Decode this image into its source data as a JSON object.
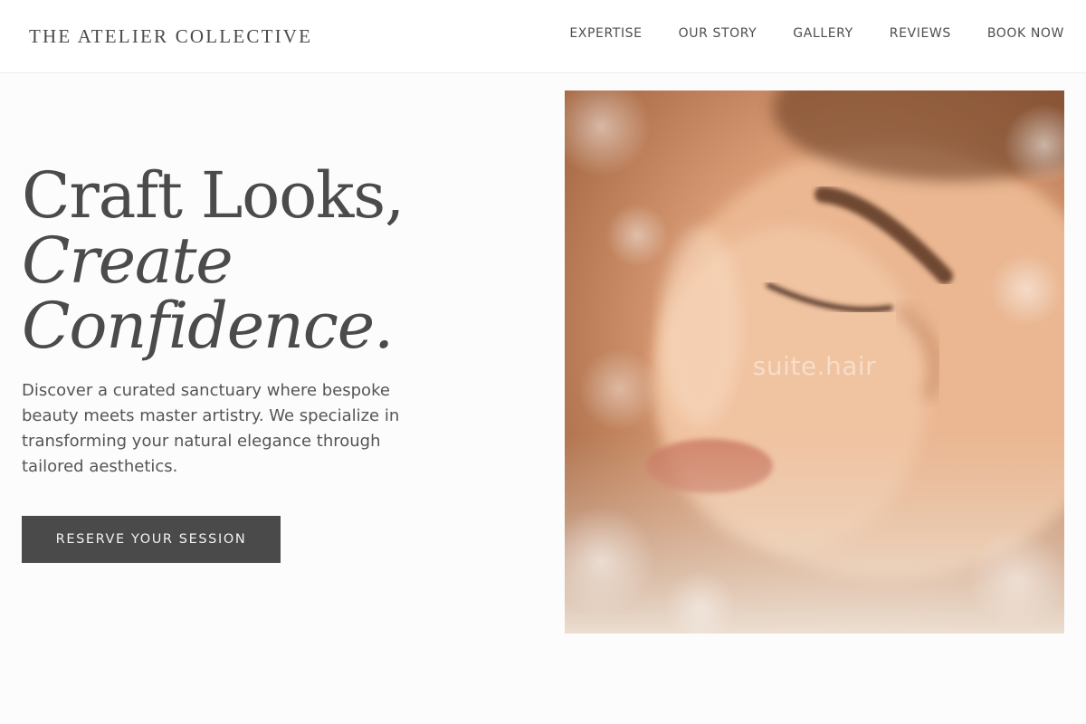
{
  "header": {
    "brand": "THE ATELIER COLLECTIVE",
    "nav": [
      {
        "label": "EXPERTISE"
      },
      {
        "label": "OUR STORY"
      },
      {
        "label": "GALLERY"
      },
      {
        "label": "REVIEWS"
      },
      {
        "label": "BOOK NOW"
      }
    ]
  },
  "hero": {
    "title_line1": "Craft Looks,",
    "title_line2": "Create",
    "title_line3": "Confidence.",
    "description": "Discover a curated sanctuary where bespoke beauty meets master artistry. We specialize in transforming your natural elegance through tailored aesthetics.",
    "cta_label": "RESERVE YOUR SESSION",
    "image_watermark": "suite.hair"
  },
  "colors": {
    "text_dark": "#4b4b4b",
    "cta_background": "#4a4a4a",
    "page_background": "#fcfcfc"
  }
}
